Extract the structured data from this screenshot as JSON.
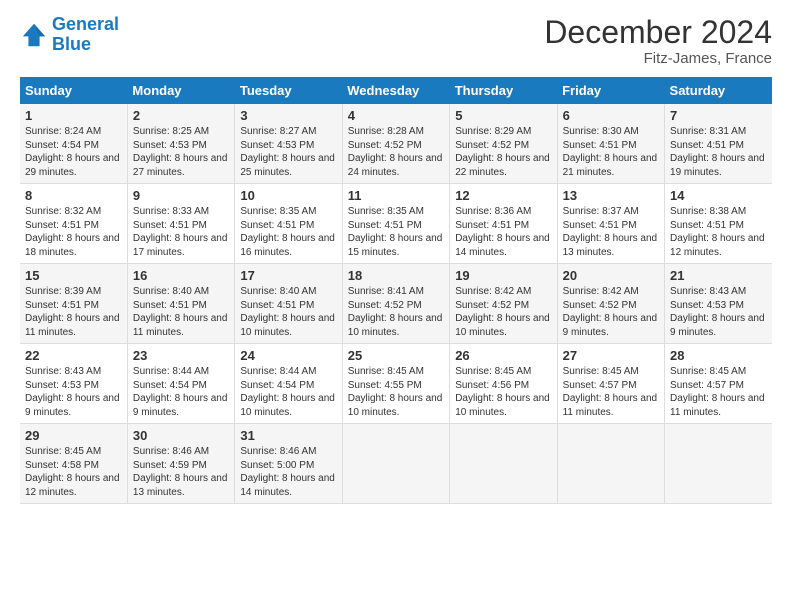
{
  "header": {
    "logo_line1": "General",
    "logo_line2": "Blue",
    "month": "December 2024",
    "location": "Fitz-James, France"
  },
  "days_of_week": [
    "Sunday",
    "Monday",
    "Tuesday",
    "Wednesday",
    "Thursday",
    "Friday",
    "Saturday"
  ],
  "weeks": [
    [
      {
        "day": "1",
        "sunrise": "8:24 AM",
        "sunset": "4:54 PM",
        "daylight": "8 hours and 29 minutes."
      },
      {
        "day": "2",
        "sunrise": "8:25 AM",
        "sunset": "4:53 PM",
        "daylight": "8 hours and 27 minutes."
      },
      {
        "day": "3",
        "sunrise": "8:27 AM",
        "sunset": "4:53 PM",
        "daylight": "8 hours and 25 minutes."
      },
      {
        "day": "4",
        "sunrise": "8:28 AM",
        "sunset": "4:52 PM",
        "daylight": "8 hours and 24 minutes."
      },
      {
        "day": "5",
        "sunrise": "8:29 AM",
        "sunset": "4:52 PM",
        "daylight": "8 hours and 22 minutes."
      },
      {
        "day": "6",
        "sunrise": "8:30 AM",
        "sunset": "4:51 PM",
        "daylight": "8 hours and 21 minutes."
      },
      {
        "day": "7",
        "sunrise": "8:31 AM",
        "sunset": "4:51 PM",
        "daylight": "8 hours and 19 minutes."
      }
    ],
    [
      {
        "day": "8",
        "sunrise": "8:32 AM",
        "sunset": "4:51 PM",
        "daylight": "8 hours and 18 minutes."
      },
      {
        "day": "9",
        "sunrise": "8:33 AM",
        "sunset": "4:51 PM",
        "daylight": "8 hours and 17 minutes."
      },
      {
        "day": "10",
        "sunrise": "8:35 AM",
        "sunset": "4:51 PM",
        "daylight": "8 hours and 16 minutes."
      },
      {
        "day": "11",
        "sunrise": "8:35 AM",
        "sunset": "4:51 PM",
        "daylight": "8 hours and 15 minutes."
      },
      {
        "day": "12",
        "sunrise": "8:36 AM",
        "sunset": "4:51 PM",
        "daylight": "8 hours and 14 minutes."
      },
      {
        "day": "13",
        "sunrise": "8:37 AM",
        "sunset": "4:51 PM",
        "daylight": "8 hours and 13 minutes."
      },
      {
        "day": "14",
        "sunrise": "8:38 AM",
        "sunset": "4:51 PM",
        "daylight": "8 hours and 12 minutes."
      }
    ],
    [
      {
        "day": "15",
        "sunrise": "8:39 AM",
        "sunset": "4:51 PM",
        "daylight": "8 hours and 11 minutes."
      },
      {
        "day": "16",
        "sunrise": "8:40 AM",
        "sunset": "4:51 PM",
        "daylight": "8 hours and 11 minutes."
      },
      {
        "day": "17",
        "sunrise": "8:40 AM",
        "sunset": "4:51 PM",
        "daylight": "8 hours and 10 minutes."
      },
      {
        "day": "18",
        "sunrise": "8:41 AM",
        "sunset": "4:52 PM",
        "daylight": "8 hours and 10 minutes."
      },
      {
        "day": "19",
        "sunrise": "8:42 AM",
        "sunset": "4:52 PM",
        "daylight": "8 hours and 10 minutes."
      },
      {
        "day": "20",
        "sunrise": "8:42 AM",
        "sunset": "4:52 PM",
        "daylight": "8 hours and 9 minutes."
      },
      {
        "day": "21",
        "sunrise": "8:43 AM",
        "sunset": "4:53 PM",
        "daylight": "8 hours and 9 minutes."
      }
    ],
    [
      {
        "day": "22",
        "sunrise": "8:43 AM",
        "sunset": "4:53 PM",
        "daylight": "8 hours and 9 minutes."
      },
      {
        "day": "23",
        "sunrise": "8:44 AM",
        "sunset": "4:54 PM",
        "daylight": "8 hours and 9 minutes."
      },
      {
        "day": "24",
        "sunrise": "8:44 AM",
        "sunset": "4:54 PM",
        "daylight": "8 hours and 10 minutes."
      },
      {
        "day": "25",
        "sunrise": "8:45 AM",
        "sunset": "4:55 PM",
        "daylight": "8 hours and 10 minutes."
      },
      {
        "day": "26",
        "sunrise": "8:45 AM",
        "sunset": "4:56 PM",
        "daylight": "8 hours and 10 minutes."
      },
      {
        "day": "27",
        "sunrise": "8:45 AM",
        "sunset": "4:57 PM",
        "daylight": "8 hours and 11 minutes."
      },
      {
        "day": "28",
        "sunrise": "8:45 AM",
        "sunset": "4:57 PM",
        "daylight": "8 hours and 11 minutes."
      }
    ],
    [
      {
        "day": "29",
        "sunrise": "8:45 AM",
        "sunset": "4:58 PM",
        "daylight": "8 hours and 12 minutes."
      },
      {
        "day": "30",
        "sunrise": "8:46 AM",
        "sunset": "4:59 PM",
        "daylight": "8 hours and 13 minutes."
      },
      {
        "day": "31",
        "sunrise": "8:46 AM",
        "sunset": "5:00 PM",
        "daylight": "8 hours and 14 minutes."
      },
      null,
      null,
      null,
      null
    ]
  ]
}
